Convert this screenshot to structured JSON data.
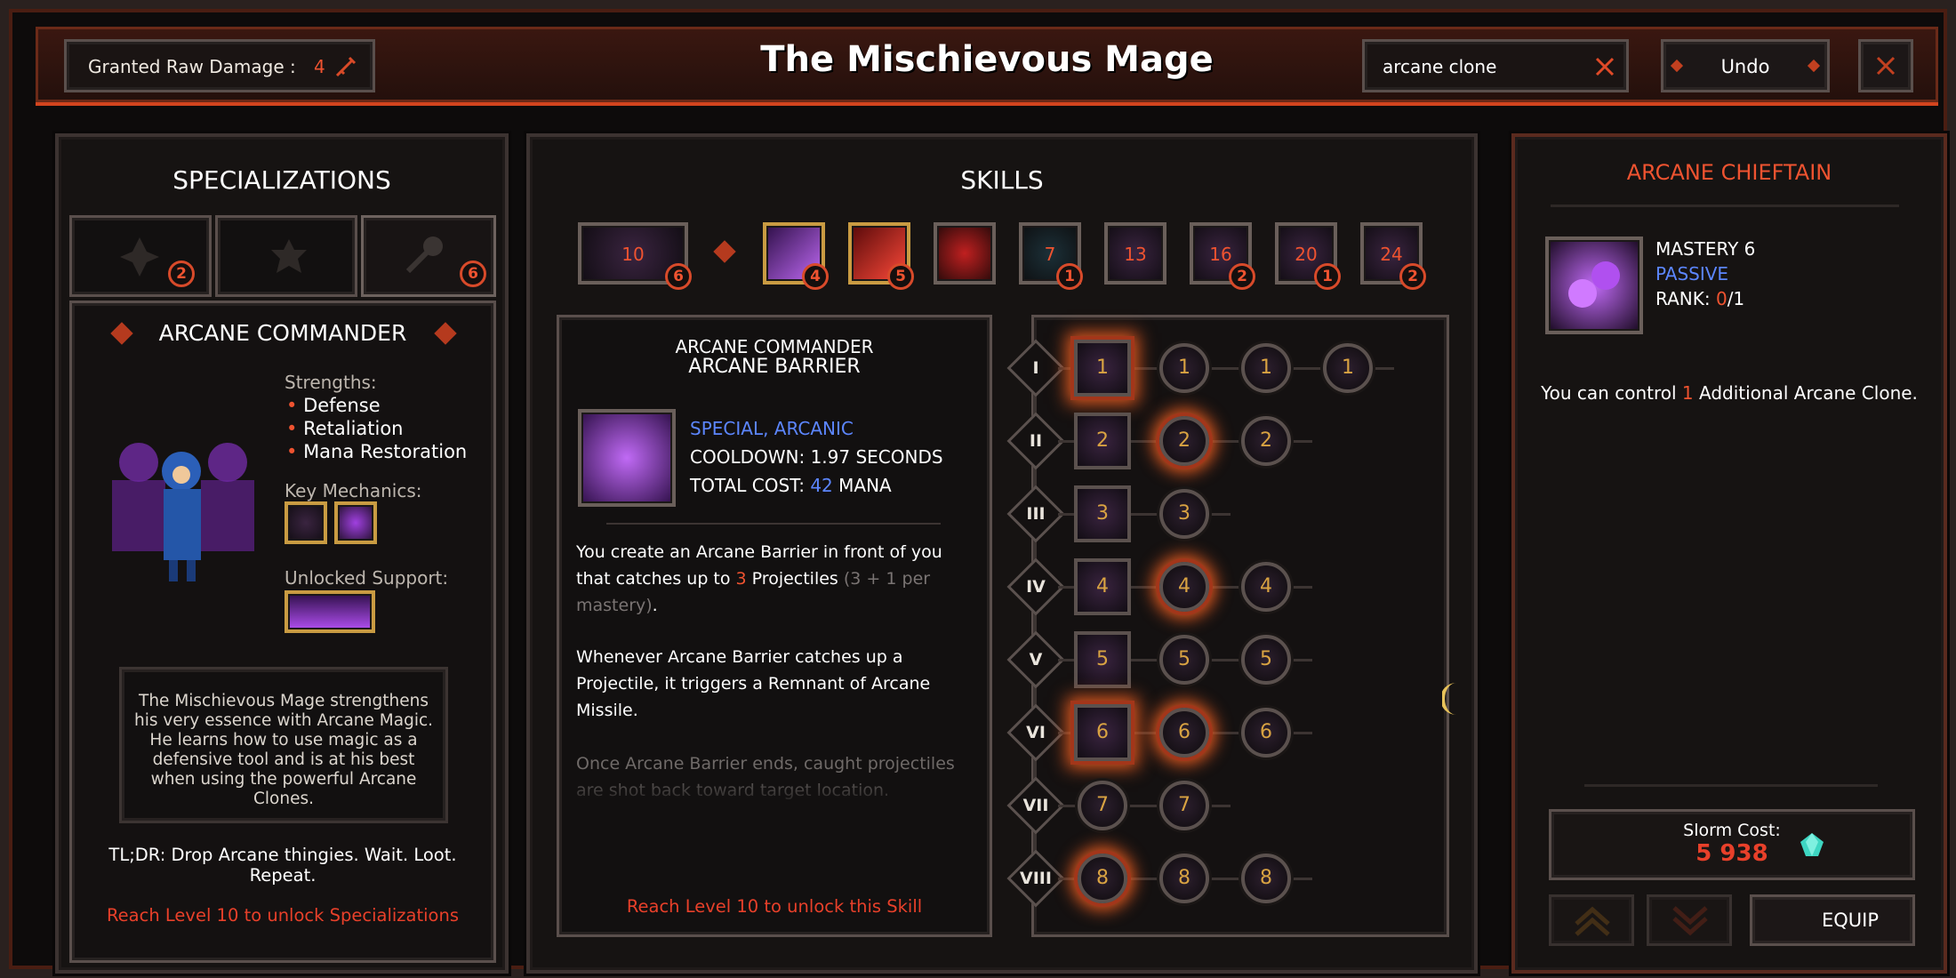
{
  "topbar": {
    "granted_label": "Granted Raw Damage :",
    "granted_value": "4",
    "title": "The Mischievous Mage",
    "search_value": "arcane clone",
    "undo_label": "Undo"
  },
  "specializations": {
    "header": "SPECIALIZATIONS",
    "tabs": [
      {
        "count": "2"
      },
      {
        "count": ""
      },
      {
        "count": "6"
      }
    ],
    "name": "ARCANE COMMANDER",
    "strengths_label": "Strengths:",
    "strengths": [
      "Defense",
      "Retaliation",
      "Mana Restoration"
    ],
    "key_mechanics_label": "Key Mechanics:",
    "unlocked_support_label": "Unlocked Support:",
    "description": "The Mischievous Mage strengthens his very essence with Arcane Magic. He learns how to use magic as a defensive tool and is at his best when using the powerful Arcane Clones.",
    "tldr": "TL;DR: Drop Arcane thingies. Wait. Loot. Repeat.",
    "unlock_msg": "Reach Level 10 to unlock Specializations"
  },
  "skills": {
    "header": "SKILLS",
    "tiles": [
      {
        "level": "10",
        "count": "6"
      },
      {
        "level": "",
        "count": "4"
      },
      {
        "level": "",
        "count": "5"
      },
      {
        "level": "",
        "count": ""
      },
      {
        "level": "7",
        "count": "1"
      },
      {
        "level": "13",
        "count": ""
      },
      {
        "level": "16",
        "count": "2"
      },
      {
        "level": "20",
        "count": "1"
      },
      {
        "level": "24",
        "count": "2"
      }
    ],
    "detail": {
      "subtitle": "ARCANE COMMANDER",
      "title": "ARCANE BARRIER",
      "tags": "SPECIAL, ARCANIC",
      "cooldown": "COOLDOWN: 1.97 SECONDS",
      "cost_label": "TOTAL COST:",
      "cost_value": "42",
      "cost_unit": "MANA",
      "p1_a": "You create an Arcane Barrier in front of you that catches up to ",
      "p1_num": "3",
      "p1_b": " Projectiles ",
      "p1_grey": "(3 + 1 per mastery)",
      "p1_end": ".",
      "p2": "Whenever Arcane Barrier catches up a Projectile, it triggers a Remnant of Arcane Missile.",
      "p3": "Once Arcane Barrier ends, caught projectiles are shot back toward target location.",
      "unlock_msg": "Reach Level 10 to unlock this Skill"
    },
    "tree_rows": [
      {
        "roman": "I",
        "nodes": [
          "1",
          "1",
          "1",
          "1"
        ]
      },
      {
        "roman": "II",
        "nodes": [
          "2",
          "2",
          "2"
        ]
      },
      {
        "roman": "III",
        "nodes": [
          "3",
          "3"
        ]
      },
      {
        "roman": "IV",
        "nodes": [
          "4",
          "4",
          "4"
        ]
      },
      {
        "roman": "V",
        "nodes": [
          "5",
          "5",
          "5"
        ]
      },
      {
        "roman": "VI",
        "nodes": [
          "6",
          "6",
          "6"
        ]
      },
      {
        "roman": "VII",
        "nodes": [
          "7",
          "7"
        ]
      },
      {
        "roman": "VIII",
        "nodes": [
          "8",
          "8",
          "8"
        ]
      }
    ]
  },
  "upgrade": {
    "title": "ARCANE CHIEFTAIN",
    "mastery": "MASTERY 6",
    "type": "PASSIVE",
    "rank_label": "RANK:",
    "rank_value": "0",
    "rank_max": "/1",
    "desc_a": "You can control ",
    "desc_num": "1",
    "desc_b": " Additional Arcane Clone.",
    "cost_label": "Slorm Cost:",
    "cost_value": "5 938",
    "equip_label": "EQUIP"
  }
}
